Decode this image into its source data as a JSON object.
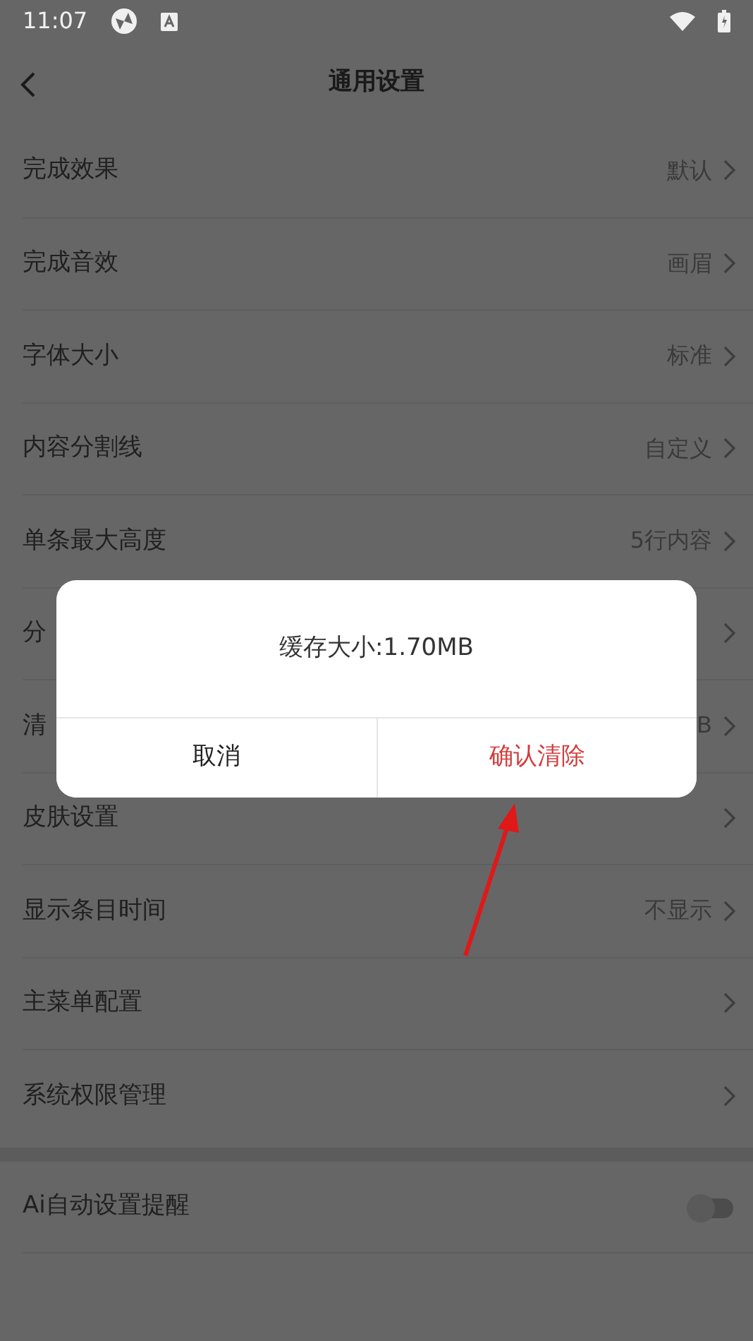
{
  "status_bar": {
    "time": "11:07"
  },
  "header": {
    "title": "通用设置"
  },
  "rows": [
    {
      "label": "完成效果",
      "value": "默认"
    },
    {
      "label": "完成音效",
      "value": "画眉"
    },
    {
      "label": "字体大小",
      "value": "标准"
    },
    {
      "label": "内容分割线",
      "value": "自定义"
    },
    {
      "label": "单条最大高度",
      "value": "5行内容"
    },
    {
      "label": "分"
    },
    {
      "label": "清",
      "value": "B"
    },
    {
      "label": "皮肤设置"
    },
    {
      "label": "显示条目时间",
      "value": "不显示"
    },
    {
      "label": "主菜单配置"
    },
    {
      "label": "系统权限管理"
    }
  ],
  "toggles": [
    {
      "label": "Ai自动设置提醒",
      "on": false
    }
  ],
  "dialog": {
    "message": "缓存大小:1.70MB",
    "buttons": [
      {
        "label": "取消",
        "kind": "cancel"
      },
      {
        "label": "确认清除",
        "kind": "confirm"
      }
    ]
  }
}
